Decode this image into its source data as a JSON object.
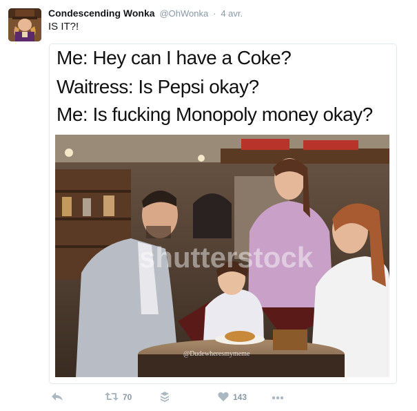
{
  "tweet": {
    "author_name": "Condescending Wonka",
    "handle": "@OhWonka",
    "separator": "·",
    "date": "4 avr.",
    "text": "IS IT?!"
  },
  "meme": {
    "lines": [
      "Me: Hey can I have a Coke?",
      "Waitress: Is Pepsi okay?",
      "Me: Is fucking Monopoly money okay?"
    ],
    "watermark": "shutterstock",
    "credit": "@Dudewheresmymeme"
  },
  "actions": {
    "reply_icon": "reply-icon",
    "retweet_icon": "retweet-icon",
    "retweet_count": "70",
    "stack_icon": "stack-icon",
    "like_icon": "heart-icon",
    "like_count": "143",
    "more_icon": "more-icon"
  },
  "colors": {
    "name": "#14171a",
    "meta": "#8899a6",
    "action_icon": "#aab8c2",
    "card_border": "#e1e8ed"
  }
}
